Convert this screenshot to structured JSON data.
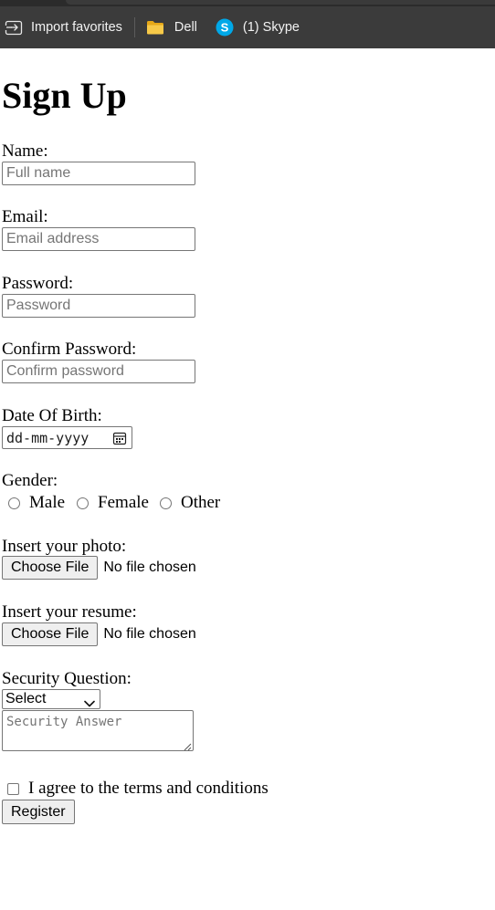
{
  "favorites_bar": {
    "items": [
      {
        "label": "Import favorites",
        "icon": "import-favorites-icon"
      },
      {
        "label": "Dell",
        "icon": "folder-icon"
      },
      {
        "label": "(1) Skype",
        "icon": "skype-icon"
      }
    ]
  },
  "form": {
    "title": "Sign Up",
    "name": {
      "label": "Name:",
      "placeholder": "Full name"
    },
    "email": {
      "label": "Email:",
      "placeholder": "Email address"
    },
    "password": {
      "label": "Password:",
      "placeholder": "Password"
    },
    "confirm_password": {
      "label": "Confirm Password:",
      "placeholder": "Confirm password"
    },
    "dob": {
      "label": "Date Of Birth:",
      "placeholder": "dd-mm-yyyy",
      "icon": "calendar-icon"
    },
    "gender": {
      "label": "Gender:",
      "options": [
        "Male",
        "Female",
        "Other"
      ]
    },
    "photo": {
      "label": "Insert your photo:",
      "button": "Choose File",
      "status": "No file chosen"
    },
    "resume": {
      "label": "Insert your resume:",
      "button": "Choose File",
      "status": "No file chosen"
    },
    "security": {
      "label": "Security Question:",
      "selected": "Select",
      "answer_placeholder": "Security Answer"
    },
    "terms": {
      "label": "I agree to the terms and conditions"
    },
    "submit": {
      "label": "Register"
    }
  },
  "colors": {
    "favbar_bg": "#3b3b3b",
    "skype_blue": "#00a8e8",
    "folder_yellow": "#f7c948"
  }
}
